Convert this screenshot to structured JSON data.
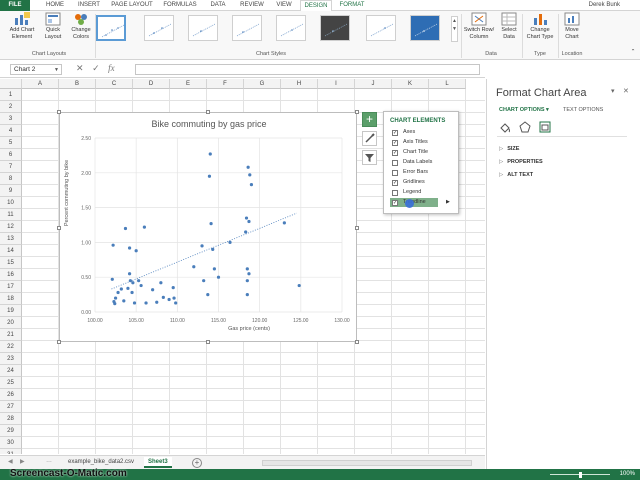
{
  "ribbon": {
    "tabs": [
      "FILE",
      "HOME",
      "INSERT",
      "PAGE LAYOUT",
      "FORMULAS",
      "DATA",
      "REVIEW",
      "VIEW",
      "DESIGN",
      "FORMAT"
    ],
    "active_tab": "DESIGN",
    "user": "Derek Bunk",
    "buttons": {
      "add_chart_element": "Add Chart Element",
      "quick_layout": "Quick Layout",
      "change_colors": "Change Colors",
      "switch_row_column": "Switch Row/ Column",
      "select_data": "Select Data",
      "change_chart_type": "Change Chart Type",
      "move_chart": "Move Chart"
    },
    "groups": {
      "chart_layouts": "Chart Layouts",
      "chart_styles": "Chart Styles",
      "data": "Data",
      "type": "Type",
      "location": "Location"
    }
  },
  "formula_bar": {
    "name_box": "Chart 2",
    "fx": "fx",
    "value": ""
  },
  "columns": [
    "A",
    "B",
    "C",
    "D",
    "E",
    "F",
    "G",
    "H",
    "I",
    "J",
    "K",
    "L"
  ],
  "rows": [
    "1",
    "2",
    "3",
    "4",
    "5",
    "6",
    "7",
    "8",
    "9",
    "10",
    "11",
    "12",
    "13",
    "14",
    "15",
    "16",
    "17",
    "18",
    "19",
    "20",
    "21",
    "22",
    "23",
    "24",
    "25",
    "26",
    "27",
    "28",
    "29",
    "30",
    "31"
  ],
  "chart_data": {
    "type": "scatter",
    "title": "Bike commuting by gas price",
    "xlabel": "Gas price (cents)",
    "ylabel": "Percent commuting by bike",
    "xlim": [
      100,
      130
    ],
    "ylim": [
      0,
      2.5
    ],
    "x_ticks": [
      "100.00",
      "105.00",
      "110.00",
      "115.00",
      "120.00",
      "125.00",
      "130.00"
    ],
    "y_ticks": [
      "0.00",
      "0.50",
      "1.00",
      "1.50",
      "2.00",
      "2.50"
    ],
    "grid": true,
    "trendline": {
      "type": "linear",
      "style": "dotted",
      "x": [
        102,
        124.5
      ],
      "y": [
        0.33,
        1.42
      ]
    },
    "series": [
      {
        "x": [
          102.1,
          102.2,
          102.3,
          102.4,
          102.5,
          102.8,
          103.2,
          103.5,
          103.7,
          104.0,
          104.2,
          104.2,
          104.3,
          104.5,
          104.6,
          104.8,
          105.0,
          105.3,
          105.6,
          106.0,
          106.2,
          107.0,
          107.5,
          108.0,
          108.3,
          109.0,
          109.5,
          109.6,
          109.8,
          112.0,
          113.0,
          113.2,
          113.7,
          113.9,
          114.0,
          114.1,
          114.3,
          114.5,
          115.0,
          116.4,
          118.3,
          118.4,
          118.5,
          118.5,
          118.5,
          118.6,
          118.7,
          118.7,
          118.8,
          119.0,
          123.0,
          124.8
        ],
        "y": [
          0.47,
          0.96,
          0.15,
          0.12,
          0.2,
          0.28,
          0.33,
          0.16,
          1.2,
          0.34,
          0.92,
          0.55,
          0.45,
          0.28,
          0.42,
          0.13,
          0.88,
          0.45,
          0.38,
          1.22,
          0.13,
          0.32,
          0.14,
          0.42,
          0.21,
          0.18,
          0.35,
          0.2,
          0.13,
          0.65,
          0.95,
          0.45,
          0.25,
          1.95,
          2.27,
          1.27,
          0.9,
          0.62,
          0.5,
          1.0,
          1.15,
          1.35,
          0.25,
          0.45,
          0.62,
          2.08,
          0.55,
          1.3,
          1.97,
          1.83,
          1.28,
          0.38
        ]
      }
    ]
  },
  "chart_elements": {
    "title": "CHART ELEMENTS",
    "items": [
      {
        "label": "Axes",
        "checked": true
      },
      {
        "label": "Axis Titles",
        "checked": true
      },
      {
        "label": "Chart Title",
        "checked": true
      },
      {
        "label": "Data Labels",
        "checked": false
      },
      {
        "label": "Error Bars",
        "checked": false
      },
      {
        "label": "Gridlines",
        "checked": true
      },
      {
        "label": "Legend",
        "checked": false
      },
      {
        "label": "Trendline",
        "checked": true
      }
    ]
  },
  "format_pane": {
    "title": "Format Chart Area",
    "tab_chart_options": "CHART OPTIONS",
    "tab_text_options": "TEXT OPTIONS",
    "sections": [
      "SIZE",
      "PROPERTIES",
      "ALT TEXT"
    ]
  },
  "sheets": {
    "tabs": [
      "example_bike_data2.csv",
      "Sheet3"
    ],
    "active": "Sheet3"
  },
  "status": {
    "watermark": "Screencast-O-Matic.com",
    "zoom": "100%"
  },
  "colors": {
    "excel_green": "#217346",
    "marker_blue": "#4a7ebb",
    "flyout_highlight": "#7fb08a"
  }
}
